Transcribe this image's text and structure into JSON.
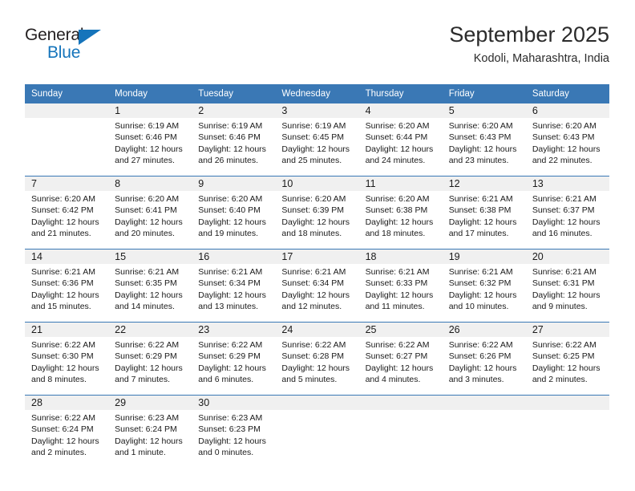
{
  "brand": {
    "name_part1": "General",
    "name_part2": "Blue",
    "accent_color": "#1574bb"
  },
  "header": {
    "title": "September 2025",
    "subtitle": "Kodoli, Maharashtra, India"
  },
  "theme": {
    "header_blue": "#3a78b5",
    "daynum_band": "#f0f0f0"
  },
  "weekdays": [
    "Sunday",
    "Monday",
    "Tuesday",
    "Wednesday",
    "Thursday",
    "Friday",
    "Saturday"
  ],
  "weeks": [
    [
      {
        "day": "",
        "sunrise": "",
        "sunset": "",
        "daylight_line1": "",
        "daylight_line2": ""
      },
      {
        "day": "1",
        "sunrise": "Sunrise: 6:19 AM",
        "sunset": "Sunset: 6:46 PM",
        "daylight_line1": "Daylight: 12 hours",
        "daylight_line2": "and 27 minutes."
      },
      {
        "day": "2",
        "sunrise": "Sunrise: 6:19 AM",
        "sunset": "Sunset: 6:46 PM",
        "daylight_line1": "Daylight: 12 hours",
        "daylight_line2": "and 26 minutes."
      },
      {
        "day": "3",
        "sunrise": "Sunrise: 6:19 AM",
        "sunset": "Sunset: 6:45 PM",
        "daylight_line1": "Daylight: 12 hours",
        "daylight_line2": "and 25 minutes."
      },
      {
        "day": "4",
        "sunrise": "Sunrise: 6:20 AM",
        "sunset": "Sunset: 6:44 PM",
        "daylight_line1": "Daylight: 12 hours",
        "daylight_line2": "and 24 minutes."
      },
      {
        "day": "5",
        "sunrise": "Sunrise: 6:20 AM",
        "sunset": "Sunset: 6:43 PM",
        "daylight_line1": "Daylight: 12 hours",
        "daylight_line2": "and 23 minutes."
      },
      {
        "day": "6",
        "sunrise": "Sunrise: 6:20 AM",
        "sunset": "Sunset: 6:43 PM",
        "daylight_line1": "Daylight: 12 hours",
        "daylight_line2": "and 22 minutes."
      }
    ],
    [
      {
        "day": "7",
        "sunrise": "Sunrise: 6:20 AM",
        "sunset": "Sunset: 6:42 PM",
        "daylight_line1": "Daylight: 12 hours",
        "daylight_line2": "and 21 minutes."
      },
      {
        "day": "8",
        "sunrise": "Sunrise: 6:20 AM",
        "sunset": "Sunset: 6:41 PM",
        "daylight_line1": "Daylight: 12 hours",
        "daylight_line2": "and 20 minutes."
      },
      {
        "day": "9",
        "sunrise": "Sunrise: 6:20 AM",
        "sunset": "Sunset: 6:40 PM",
        "daylight_line1": "Daylight: 12 hours",
        "daylight_line2": "and 19 minutes."
      },
      {
        "day": "10",
        "sunrise": "Sunrise: 6:20 AM",
        "sunset": "Sunset: 6:39 PM",
        "daylight_line1": "Daylight: 12 hours",
        "daylight_line2": "and 18 minutes."
      },
      {
        "day": "11",
        "sunrise": "Sunrise: 6:20 AM",
        "sunset": "Sunset: 6:38 PM",
        "daylight_line1": "Daylight: 12 hours",
        "daylight_line2": "and 18 minutes."
      },
      {
        "day": "12",
        "sunrise": "Sunrise: 6:21 AM",
        "sunset": "Sunset: 6:38 PM",
        "daylight_line1": "Daylight: 12 hours",
        "daylight_line2": "and 17 minutes."
      },
      {
        "day": "13",
        "sunrise": "Sunrise: 6:21 AM",
        "sunset": "Sunset: 6:37 PM",
        "daylight_line1": "Daylight: 12 hours",
        "daylight_line2": "and 16 minutes."
      }
    ],
    [
      {
        "day": "14",
        "sunrise": "Sunrise: 6:21 AM",
        "sunset": "Sunset: 6:36 PM",
        "daylight_line1": "Daylight: 12 hours",
        "daylight_line2": "and 15 minutes."
      },
      {
        "day": "15",
        "sunrise": "Sunrise: 6:21 AM",
        "sunset": "Sunset: 6:35 PM",
        "daylight_line1": "Daylight: 12 hours",
        "daylight_line2": "and 14 minutes."
      },
      {
        "day": "16",
        "sunrise": "Sunrise: 6:21 AM",
        "sunset": "Sunset: 6:34 PM",
        "daylight_line1": "Daylight: 12 hours",
        "daylight_line2": "and 13 minutes."
      },
      {
        "day": "17",
        "sunrise": "Sunrise: 6:21 AM",
        "sunset": "Sunset: 6:34 PM",
        "daylight_line1": "Daylight: 12 hours",
        "daylight_line2": "and 12 minutes."
      },
      {
        "day": "18",
        "sunrise": "Sunrise: 6:21 AM",
        "sunset": "Sunset: 6:33 PM",
        "daylight_line1": "Daylight: 12 hours",
        "daylight_line2": "and 11 minutes."
      },
      {
        "day": "19",
        "sunrise": "Sunrise: 6:21 AM",
        "sunset": "Sunset: 6:32 PM",
        "daylight_line1": "Daylight: 12 hours",
        "daylight_line2": "and 10 minutes."
      },
      {
        "day": "20",
        "sunrise": "Sunrise: 6:21 AM",
        "sunset": "Sunset: 6:31 PM",
        "daylight_line1": "Daylight: 12 hours",
        "daylight_line2": "and 9 minutes."
      }
    ],
    [
      {
        "day": "21",
        "sunrise": "Sunrise: 6:22 AM",
        "sunset": "Sunset: 6:30 PM",
        "daylight_line1": "Daylight: 12 hours",
        "daylight_line2": "and 8 minutes."
      },
      {
        "day": "22",
        "sunrise": "Sunrise: 6:22 AM",
        "sunset": "Sunset: 6:29 PM",
        "daylight_line1": "Daylight: 12 hours",
        "daylight_line2": "and 7 minutes."
      },
      {
        "day": "23",
        "sunrise": "Sunrise: 6:22 AM",
        "sunset": "Sunset: 6:29 PM",
        "daylight_line1": "Daylight: 12 hours",
        "daylight_line2": "and 6 minutes."
      },
      {
        "day": "24",
        "sunrise": "Sunrise: 6:22 AM",
        "sunset": "Sunset: 6:28 PM",
        "daylight_line1": "Daylight: 12 hours",
        "daylight_line2": "and 5 minutes."
      },
      {
        "day": "25",
        "sunrise": "Sunrise: 6:22 AM",
        "sunset": "Sunset: 6:27 PM",
        "daylight_line1": "Daylight: 12 hours",
        "daylight_line2": "and 4 minutes."
      },
      {
        "day": "26",
        "sunrise": "Sunrise: 6:22 AM",
        "sunset": "Sunset: 6:26 PM",
        "daylight_line1": "Daylight: 12 hours",
        "daylight_line2": "and 3 minutes."
      },
      {
        "day": "27",
        "sunrise": "Sunrise: 6:22 AM",
        "sunset": "Sunset: 6:25 PM",
        "daylight_line1": "Daylight: 12 hours",
        "daylight_line2": "and 2 minutes."
      }
    ],
    [
      {
        "day": "28",
        "sunrise": "Sunrise: 6:22 AM",
        "sunset": "Sunset: 6:24 PM",
        "daylight_line1": "Daylight: 12 hours",
        "daylight_line2": "and 2 minutes."
      },
      {
        "day": "29",
        "sunrise": "Sunrise: 6:23 AM",
        "sunset": "Sunset: 6:24 PM",
        "daylight_line1": "Daylight: 12 hours",
        "daylight_line2": "and 1 minute."
      },
      {
        "day": "30",
        "sunrise": "Sunrise: 6:23 AM",
        "sunset": "Sunset: 6:23 PM",
        "daylight_line1": "Daylight: 12 hours",
        "daylight_line2": "and 0 minutes."
      },
      {
        "day": "",
        "sunrise": "",
        "sunset": "",
        "daylight_line1": "",
        "daylight_line2": ""
      },
      {
        "day": "",
        "sunrise": "",
        "sunset": "",
        "daylight_line1": "",
        "daylight_line2": ""
      },
      {
        "day": "",
        "sunrise": "",
        "sunset": "",
        "daylight_line1": "",
        "daylight_line2": ""
      },
      {
        "day": "",
        "sunrise": "",
        "sunset": "",
        "daylight_line1": "",
        "daylight_line2": ""
      }
    ]
  ]
}
